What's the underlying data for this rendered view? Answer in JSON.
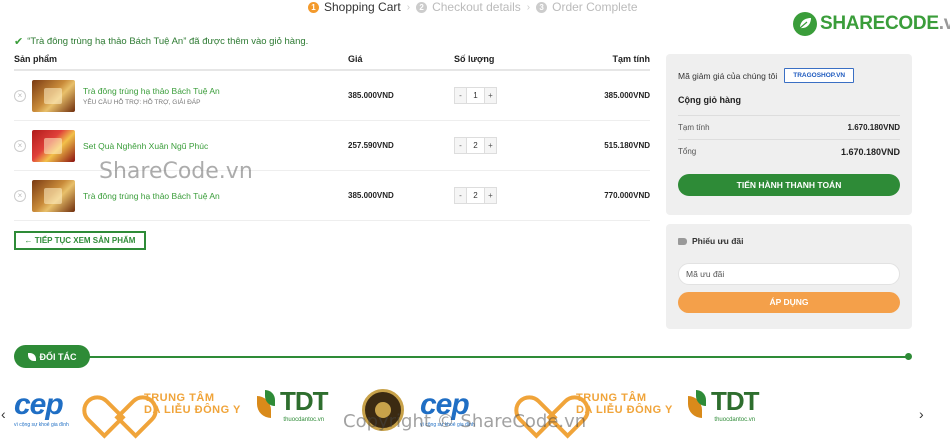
{
  "steps": [
    {
      "num": "1",
      "label": "Shopping Cart"
    },
    {
      "num": "2",
      "label": "Checkout details"
    },
    {
      "num": "3",
      "label": "Order Complete"
    }
  ],
  "step_separator": "›",
  "logo": {
    "part1": "SHARE",
    "part2": "CODE",
    "suffix": ".vn"
  },
  "notice": "“Trà đông trùng hạ thảo Bách Tuệ An” đã được thêm vào giỏ hàng.",
  "table": {
    "headers": {
      "product": "Sản phẩm",
      "price": "Giá",
      "quantity": "Số lượng",
      "subtotal": "Tạm tính"
    },
    "rows": [
      {
        "name": "Trà đông trùng hạ thảo Bách Tuệ An",
        "meta": "YÊU CẦU HỖ TRỢ: HỖ TRỢ, GIẢI ĐÁP",
        "price": "385.000VND",
        "qty": "1",
        "subtotal": "385.000VND"
      },
      {
        "name": "Set Quà Nghênh Xuân Ngũ Phúc",
        "meta": "",
        "price": "257.590VND",
        "qty": "2",
        "subtotal": "515.180VND"
      },
      {
        "name": "Trà đông trùng hạ thảo Bách Tuệ An",
        "meta": "",
        "price": "385.000VND",
        "qty": "2",
        "subtotal": "770.000VND"
      }
    ],
    "remove_glyph": "×",
    "minus": "-",
    "plus": "+"
  },
  "continue_label": "← TIẾP TỤC XEM SẢN PHẨM",
  "totals": {
    "coupon_label": "Mã giảm giá của chúng tôi",
    "coupon_code": "TRAGOSHOP.VN",
    "title": "Cộng giỏ hàng",
    "subtotal_label": "Tạm tính",
    "subtotal_value": "1.670.180VND",
    "total_label": "Tổng",
    "total_value": "1.670.180VND",
    "checkout_label": "TIẾN HÀNH THANH TOÁN"
  },
  "voucher": {
    "title": "Phiếu ưu đãi",
    "placeholder": "Mã ưu đãi",
    "apply_label": "ÁP DỤNG"
  },
  "partners": {
    "title": "ĐỐI TÁC",
    "logos": {
      "cep": "cep",
      "cep_sub": "vì cộng sự khoẻ gia đình",
      "ttdl_line1": "TRUNG TÂM",
      "ttdl_line2": "DA LIỄU ĐÔNG Y",
      "tdt": "TDT",
      "tdt_sub": "thuocdantoc.vn"
    },
    "prev": "‹",
    "next": "›"
  },
  "watermarks": {
    "center": "ShareCode.vn",
    "bottom": "Copyright © ShareCode.vn"
  },
  "colors": {
    "green": "#2e8b37",
    "orange": "#f4a04a",
    "link": "#3a9d3a"
  }
}
